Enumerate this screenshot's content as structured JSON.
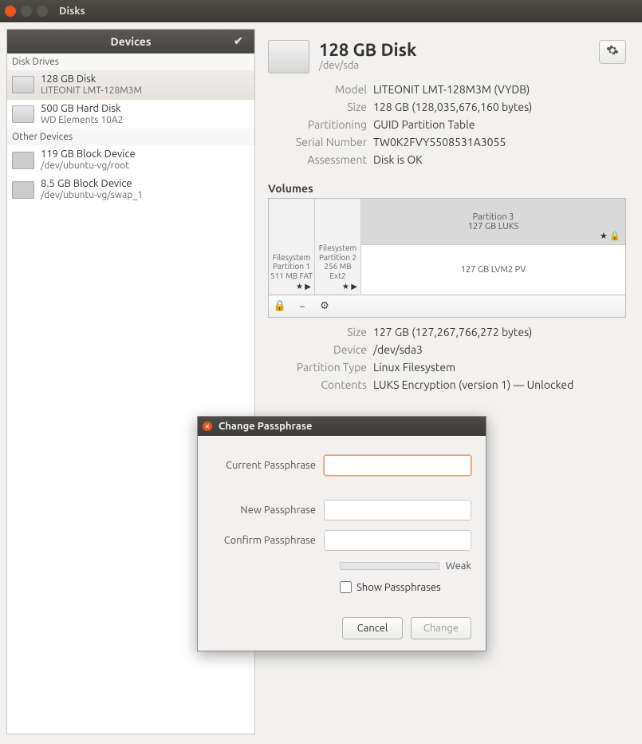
{
  "app_title": "Disks",
  "sidebar": {
    "header": "Devices",
    "sections": [
      {
        "label": "Disk Drives",
        "items": [
          {
            "title": "128 GB Disk",
            "sub": "LITEONIT LMT-128M3M",
            "selected": true
          },
          {
            "title": "500 GB Hard Disk",
            "sub": "WD Elements 10A2",
            "selected": false
          }
        ]
      },
      {
        "label": "Other Devices",
        "items": [
          {
            "title": "119 GB Block Device",
            "sub": "/dev/ubuntu-vg/root",
            "selected": false
          },
          {
            "title": "8.5 GB Block Device",
            "sub": "/dev/ubuntu-vg/swap_1",
            "selected": false
          }
        ]
      }
    ]
  },
  "disk": {
    "title": "128 GB Disk",
    "path": "/dev/sda",
    "model_label": "Model",
    "model": "LITEONIT LMT-128M3M (VYDB)",
    "size_label": "Size",
    "size": "128 GB (128,035,676,160 bytes)",
    "part_label": "Partitioning",
    "part": "GUID Partition Table",
    "serial_label": "Serial Number",
    "serial": "TW0K2FVY5508531A3055",
    "assess_label": "Assessment",
    "assess": "Disk is OK"
  },
  "volumes": {
    "header": "Volumes",
    "part1": {
      "l1": "Filesystem",
      "l2": "Partition 1",
      "l3": "511 MB FAT"
    },
    "part2": {
      "l1": "Filesystem",
      "l2": "Partition 2",
      "l3": "256 MB Ext2"
    },
    "part3": {
      "title": "Partition 3",
      "sub": "127 GB LUKS"
    },
    "lvm": "127 GB LVM2 PV",
    "selected": {
      "size_label": "Size",
      "size": "127 GB (127,267,766,272 bytes)",
      "device_label": "Device",
      "device": "/dev/sda3",
      "ptype_label": "Partition Type",
      "ptype": "Linux Filesystem",
      "contents_label": "Contents",
      "contents": "LUKS Encryption (version 1) — Unlocked"
    }
  },
  "dialog": {
    "title": "Change Passphrase",
    "current_label": "Current Passphrase",
    "new_label": "New Passphrase",
    "confirm_label": "Confirm Passphrase",
    "strength": "Weak",
    "show_label": "Show Passphrases",
    "cancel": "Cancel",
    "change": "Change"
  }
}
